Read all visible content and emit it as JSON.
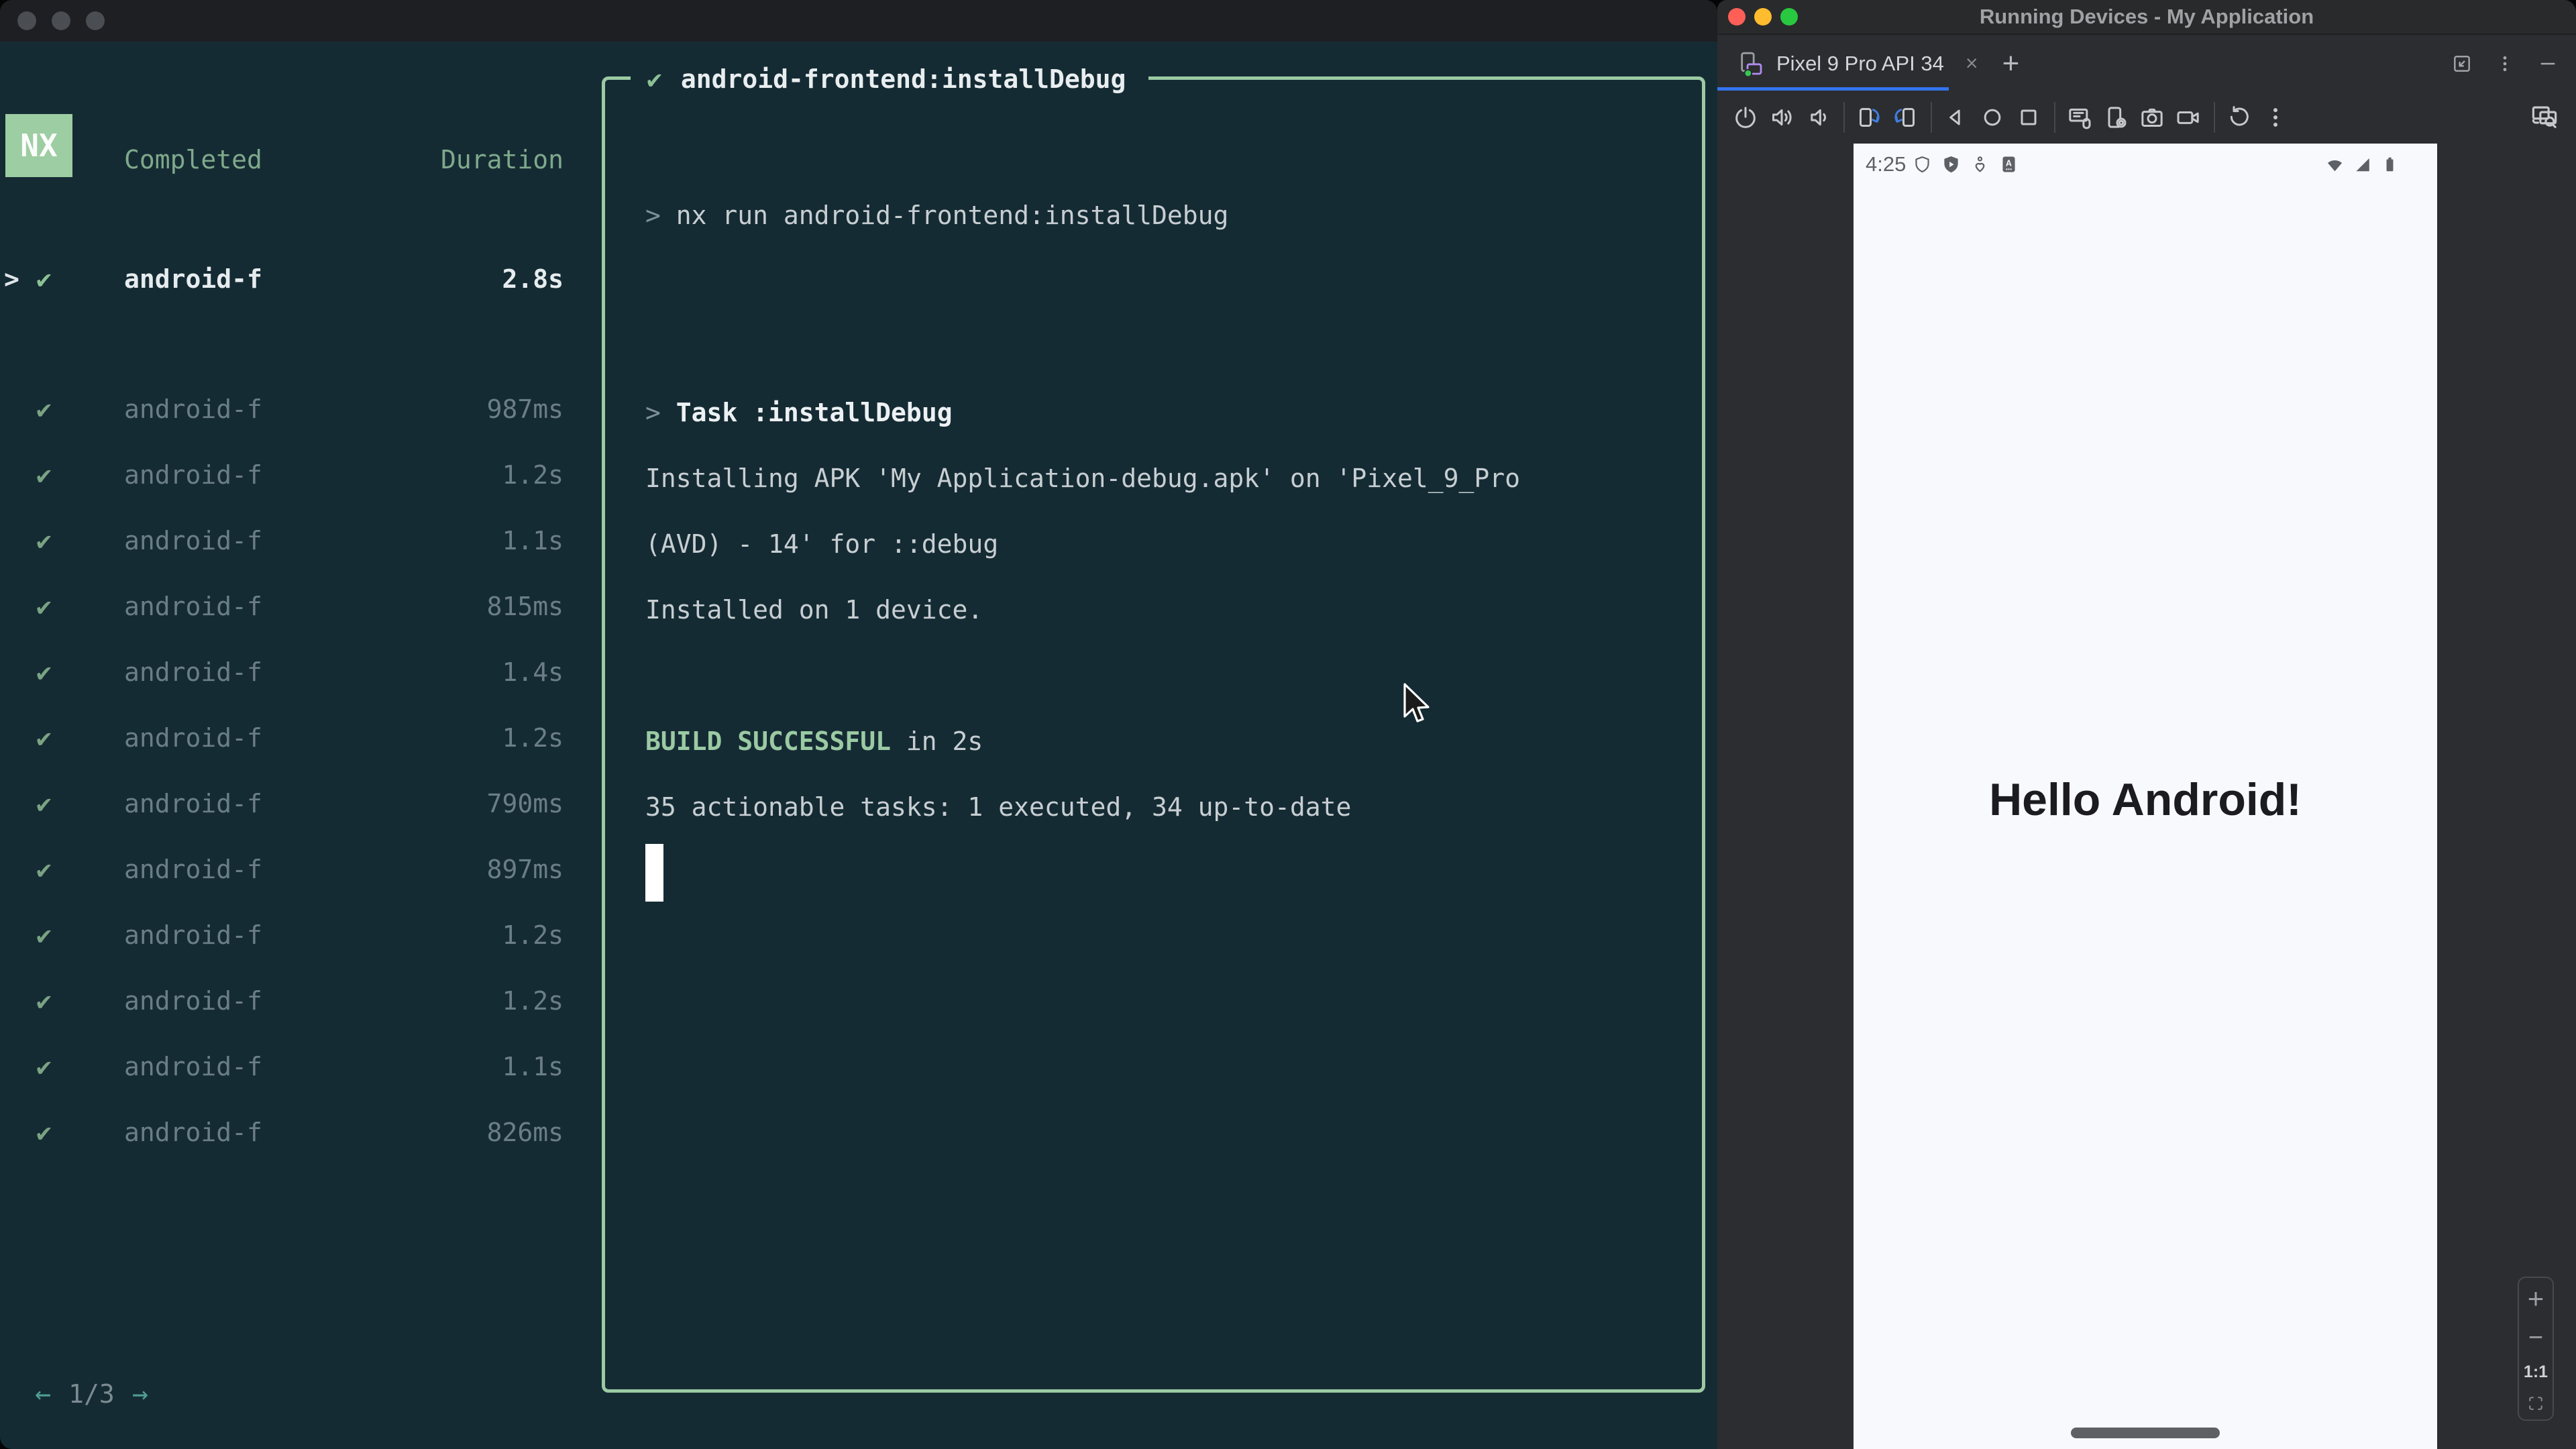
{
  "terminal": {
    "badge": "NX",
    "check_glyph": "✔",
    "caret_glyph": ">",
    "columns": {
      "completed": "Completed",
      "duration": "Duration"
    },
    "selected_task": {
      "name": "android-f",
      "duration": "2.8s"
    },
    "tasks": [
      {
        "name": "android-f",
        "duration": "987ms"
      },
      {
        "name": "android-f",
        "duration": "1.2s"
      },
      {
        "name": "android-f",
        "duration": "1.1s"
      },
      {
        "name": "android-f",
        "duration": "815ms"
      },
      {
        "name": "android-f",
        "duration": "1.4s"
      },
      {
        "name": "android-f",
        "duration": "1.2s"
      },
      {
        "name": "android-f",
        "duration": "790ms"
      },
      {
        "name": "android-f",
        "duration": "897ms"
      },
      {
        "name": "android-f",
        "duration": "1.2s"
      },
      {
        "name": "android-f",
        "duration": "1.2s"
      },
      {
        "name": "android-f",
        "duration": "1.1s"
      },
      {
        "name": "android-f",
        "duration": "826ms"
      }
    ],
    "pagination": {
      "prev": "←",
      "label": "1/3",
      "next": "→"
    },
    "output": {
      "title": "android-frontend:installDebug",
      "lines": [
        {
          "segments": [
            {
              "text": "> ",
              "style": "prompt"
            },
            {
              "text": "nx run android-frontend:installDebug",
              "style": "normal"
            }
          ]
        },
        {
          "segments": []
        },
        {
          "segments": []
        },
        {
          "segments": [
            {
              "text": "> ",
              "style": "prompt"
            },
            {
              "text": "Task :installDebug",
              "style": "bold"
            }
          ]
        },
        {
          "segments": [
            {
              "text": "Installing APK 'My Application-debug.apk' on 'Pixel_9_Pro",
              "style": "normal"
            }
          ]
        },
        {
          "segments": [
            {
              "text": "(AVD) - 14' for ::debug",
              "style": "normal"
            }
          ]
        },
        {
          "segments": [
            {
              "text": "Installed on 1 device.",
              "style": "normal"
            }
          ]
        },
        {
          "segments": []
        },
        {
          "segments": [
            {
              "text": "BUILD SUCCESSFUL",
              "style": "success"
            },
            {
              "text": " in 2s",
              "style": "normal"
            }
          ]
        },
        {
          "segments": [
            {
              "text": "35 actionable tasks: 1 executed, 34 up-to-date",
              "style": "normal"
            }
          ]
        }
      ]
    }
  },
  "studio": {
    "title": "Running Devices - My Application",
    "tab": {
      "label": "Pixel 9 Pro API 34",
      "close": "×",
      "new_tab": "+"
    },
    "tabbar_right_icons": [
      "float-window",
      "more",
      "hide"
    ],
    "toolbar": {
      "icons": [
        "power",
        "volume-up",
        "volume-down",
        "sep",
        "rotate-left",
        "rotate-right",
        "sep",
        "back",
        "home",
        "overview",
        "sep",
        "display",
        "device-settings",
        "screenshot",
        "screen-record",
        "sep",
        "reset",
        "more"
      ],
      "right_icon": "similar-screens"
    },
    "zoom_controls": {
      "zoom_in": "+",
      "zoom_out": "−",
      "actual_label": "1:1"
    },
    "colors": {
      "tab_underline": "#3574f0",
      "close_light": "#ff5f57",
      "min_light": "#febc2e",
      "max_light": "#28c840"
    }
  },
  "emulator": {
    "time": "4:25",
    "status_icons_left": [
      "shield",
      "play-protect",
      "wellbeing",
      "autofill"
    ],
    "status_icons_right": [
      "wifi",
      "signal",
      "battery"
    ],
    "hello_text": "Hello Android!"
  },
  "colors": {
    "nx_green": "#9dcda2",
    "output_border": "#9bcaa3",
    "success_green": "#9bcaa3",
    "terminal_bg": "#152b34"
  }
}
